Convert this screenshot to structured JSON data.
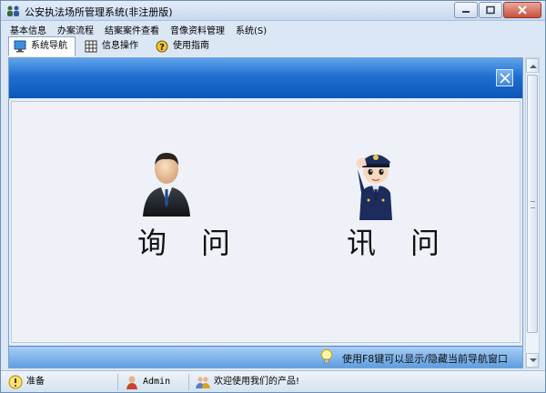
{
  "window": {
    "title": "公安执法场所管理系统(非注册版)"
  },
  "menu": [
    "基本信息",
    "办案流程",
    "结案案件查看",
    "音像资料管理",
    "系统(S)"
  ],
  "tabs": [
    {
      "label": "系统导航",
      "icon": "monitor-icon",
      "active": true
    },
    {
      "label": "信息操作",
      "icon": "grid-icon",
      "active": false
    },
    {
      "label": "使用指南",
      "icon": "help-icon",
      "active": false
    }
  ],
  "navigator": {
    "actions": [
      {
        "label": "询问",
        "icon": "businessman-icon"
      },
      {
        "label": "讯问",
        "icon": "police-officer-icon"
      }
    ],
    "hint": "使用F8键可以显示/隐藏当前导航窗口"
  },
  "status": {
    "state": "准备",
    "user": "Admin",
    "welcome": "欢迎使用我们的产品!"
  },
  "colors": {
    "nav_header": "#1f6fd1",
    "nav_footer": "#7fb6ec",
    "window_bg": "#dbe7f4"
  }
}
